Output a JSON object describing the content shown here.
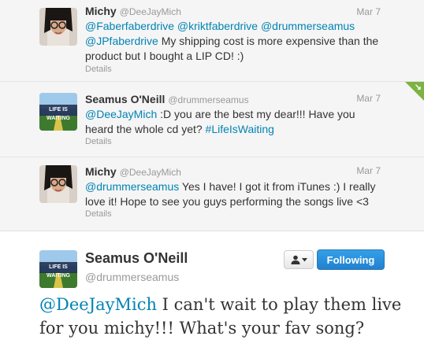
{
  "tweets": [
    {
      "name": "Michy",
      "handle": "@DeeJayMich",
      "date": "Mar 7",
      "mentions": "@Faberfaberdrive @kriktfaberdrive @drummerseamus @JPfaberdrive",
      "text": " My shipping cost is more expensive than the product but I bought a LIP CD! :)",
      "details": "Details"
    },
    {
      "name": "Seamus O'Neill",
      "handle": "@drummerseamus",
      "date": "Mar 7",
      "mention": "@DeeJayMich",
      "text": " :D you are the best my dear!!! Have you heard the whole cd yet? ",
      "hashtag": "#LifeIsWaiting",
      "details": "Details",
      "avatar_text": "LIFE IS WAITING"
    },
    {
      "name": "Michy",
      "handle": "@DeeJayMich",
      "date": "Mar 7",
      "mention": "@drummerseamus",
      "text": " Yes I have! I got it from iTunes :) I really love it! Hope to see you guys performing the songs live <3",
      "details": "Details"
    }
  ],
  "main_tweet": {
    "name": "Seamus O'Neill",
    "handle": "@drummerseamus",
    "mention": "@DeeJayMich",
    "text": " I can't wait to play them live for you michy!!! What's your fav song?",
    "follow_label": "Following",
    "avatar_text": "LIFE IS WAITING"
  },
  "colors": {
    "link": "#0084b4",
    "follow_button": "#2b8fdf",
    "conversation_bg": "#f5f5f5"
  },
  "icons": {
    "user_actions": "person-icon",
    "dropdown": "caret-down-icon",
    "corner": "arrow-down-icon"
  }
}
